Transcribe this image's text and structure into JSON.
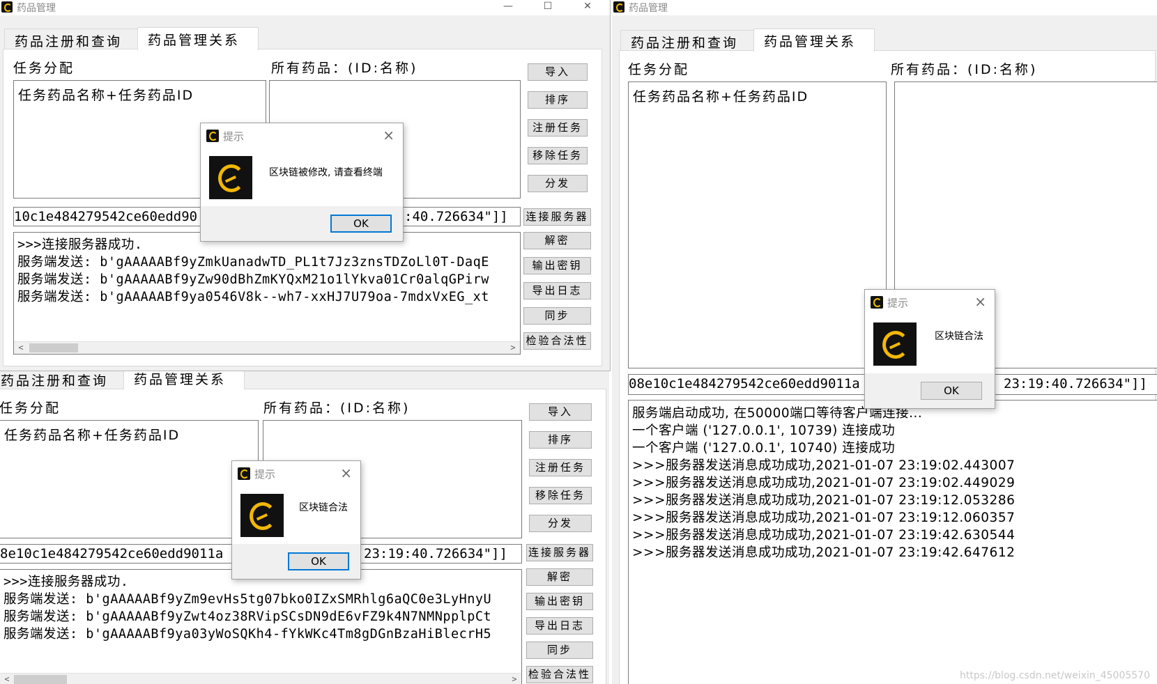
{
  "windows": {
    "top_left": {
      "title": "药品管理",
      "controls": {
        "minimize": "—",
        "maximize": "☐",
        "close": "✕"
      },
      "tabs": [
        "药品注册和查询",
        "药品管理关系"
      ],
      "task_label": "任务分配",
      "drugs_label": "所有药品：(ID:名称)",
      "task_box_text": "任务药品名称+任务药品ID",
      "entry_left": "10c1e484279542ce60edd90",
      "entry_right": ":40.726634\"]]",
      "log": [
        ">>>连接服务器成功.",
        "服务端发送: b'gAAAAABf9yZmkUanadwTD_PL1t7Jz3znsTDZoLl0T-DaqE",
        "服务端发送: b'gAAAAABf9yZw90dBhZmKYQxM21o1lYkva01Cr0alqGPirw",
        "服务端发送: b'gAAAAABf9ya0546V8k--wh7-xxHJ7U79oa-7mdxVxEG_xt"
      ],
      "buttons": [
        "导入",
        "排序",
        "注册任务",
        "移除任务",
        "分发",
        "连接服务器",
        "解密",
        "输出密钥",
        "导出日志",
        "同步",
        "检验合法性"
      ]
    },
    "right": {
      "title": "药品管理",
      "tabs": [
        "药品注册和查询",
        "药品管理关系"
      ],
      "task_label": "任务分配",
      "drugs_label": "所有药品：(ID:名称)",
      "task_box_text": "任务药品名称+任务药品ID",
      "entry_left": "08e10c1e484279542ce60edd9011a",
      "entry_right": "23:19:40.726634\"]]",
      "log": [
        "服务端启动成功, 在50000端口等待客户端连接...",
        "一个客户端 ('127.0.0.1', 10739) 连接成功",
        "一个客户端 ('127.0.0.1', 10740) 连接成功",
        ">>>服务器发送消息成功成功,2021-01-07 23:19:02.443007",
        ">>>服务器发送消息成功成功,2021-01-07 23:19:02.449029",
        ">>>服务器发送消息成功成功,2021-01-07 23:19:12.053286",
        ">>>服务器发送消息成功成功,2021-01-07 23:19:12.060357",
        ">>>服务器发送消息成功成功,2021-01-07 23:19:42.630544",
        ">>>服务器发送消息成功成功,2021-01-07 23:19:42.647612"
      ]
    },
    "bottom_left": {
      "tabs": [
        "药品注册和查询",
        "药品管理关系"
      ],
      "task_label": "任务分配",
      "drugs_label": "所有药品：(ID:名称)",
      "task_box_text": "任务药品名称+任务药品ID",
      "entry_left": "8e10c1e484279542ce60edd9011a",
      "entry_right": "23:19:40.726634\"]]",
      "log": [
        ">>>连接服务器成功.",
        "服务端发送: b'gAAAAABf9yZm9evHs5tg07bko0IZxSMRhlg6aQC0e3LyHnyU",
        "服务端发送: b'gAAAAABf9yZwt4oz38RVipSCsDN9dE6vFZ9k4N7NMNpplpCt",
        "服务端发送: b'gAAAAABf9ya03yWoSQKh4-fYkWKc4Tm8gDGnBzaHiBlecrH5"
      ],
      "buttons": [
        "导入",
        "排序",
        "注册任务",
        "移除任务",
        "分发",
        "连接服务器",
        "解密",
        "输出密钥",
        "导出日志",
        "同步",
        "检验合法性"
      ]
    }
  },
  "dialogs": {
    "modified": {
      "title": "提示",
      "message": "区块链被修改, 请查看终端",
      "ok": "OK"
    },
    "legal_right": {
      "title": "提示",
      "message": "区块链合法",
      "ok": "OK"
    },
    "legal_bottom": {
      "title": "提示",
      "message": "区块链合法",
      "ok": "OK"
    }
  },
  "scroll": {
    "left": "<",
    "right": ">"
  },
  "watermark": "https://blog.csdn.net/weixin_45005570"
}
